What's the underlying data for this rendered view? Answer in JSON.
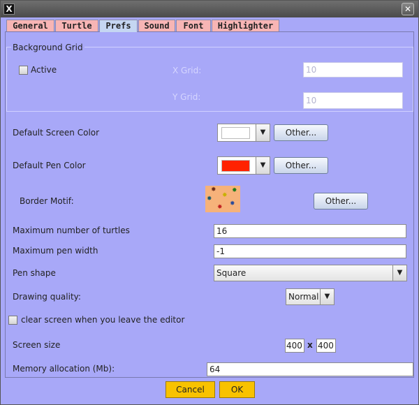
{
  "titlebar": {
    "app_icon": "X",
    "close_icon": "✕"
  },
  "tabs": [
    {
      "label": "General"
    },
    {
      "label": "Turtle"
    },
    {
      "label": "Prefs",
      "active": true
    },
    {
      "label": "Sound"
    },
    {
      "label": "Font"
    },
    {
      "label": "Highlighter"
    }
  ],
  "background_grid": {
    "title": "Background Grid",
    "active_label": "Active",
    "active_checked": false,
    "x_grid_label": "X Grid:",
    "x_grid_value": "10",
    "y_grid_label": "Y Grid:",
    "y_grid_value": "10"
  },
  "screen_color": {
    "label": "Default Screen Color",
    "color": "#ffffff",
    "other_label": "Other..."
  },
  "pen_color": {
    "label": "Default Pen Color",
    "color": "#ff2200",
    "other_label": "Other..."
  },
  "border_motif": {
    "label": "Border Motif:",
    "other_label": "Other...",
    "background": "#f6b27a"
  },
  "max_turtles": {
    "label": "Maximum number of turtles",
    "value": "16"
  },
  "max_pen_width": {
    "label": "Maximum pen width",
    "value": "-1"
  },
  "pen_shape": {
    "label": "Pen shape",
    "value": "Square"
  },
  "drawing_quality": {
    "label": "Drawing quality:",
    "value": "Normal"
  },
  "clear_screen": {
    "label": "clear screen when you leave the editor",
    "checked": false
  },
  "screen_size": {
    "label": "Screen size",
    "width": "400",
    "separator": "x",
    "height": "400"
  },
  "memory": {
    "label": "Memory allocation (Mb):",
    "value": "64"
  },
  "footer": {
    "cancel_label": "Cancel",
    "ok_label": "OK"
  }
}
